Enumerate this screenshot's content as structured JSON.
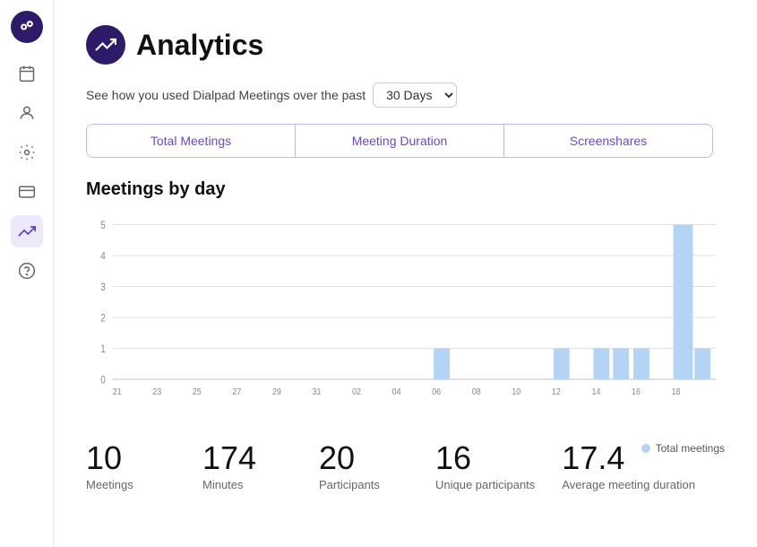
{
  "sidebar": {
    "items": [
      {
        "name": "calendar",
        "icon": "calendar",
        "active": false
      },
      {
        "name": "contacts",
        "icon": "person",
        "active": false
      },
      {
        "name": "settings",
        "icon": "gear",
        "active": false
      },
      {
        "name": "billing",
        "icon": "card",
        "active": false
      },
      {
        "name": "analytics",
        "icon": "trending-up",
        "active": true
      },
      {
        "name": "help",
        "icon": "question",
        "active": false
      }
    ]
  },
  "header": {
    "title": "Analytics"
  },
  "subtitle": {
    "text": "See how you used Dialpad Meetings over the past",
    "select_value": "30 Days"
  },
  "tabs": [
    {
      "label": "Total Meetings",
      "active": true
    },
    {
      "label": "Meeting Duration",
      "active": false
    },
    {
      "label": "Screenshares",
      "active": false
    }
  ],
  "chart": {
    "section_title": "Meetings by day",
    "y_labels": [
      "5",
      "4",
      "3",
      "2",
      "1",
      "0"
    ],
    "x_labels": [
      "21",
      "23",
      "25",
      "27",
      "29",
      "31",
      "02",
      "04",
      "06",
      "08",
      "10",
      "12",
      "14",
      "16",
      "18"
    ],
    "legend_label": "Total meetings"
  },
  "stats": [
    {
      "value": "10",
      "label": "Meetings"
    },
    {
      "value": "174",
      "label": "Minutes"
    },
    {
      "value": "20",
      "label": "Participants"
    },
    {
      "value": "16",
      "label": "Unique participants"
    },
    {
      "value": "17.4",
      "label": "Average meeting duration"
    }
  ]
}
